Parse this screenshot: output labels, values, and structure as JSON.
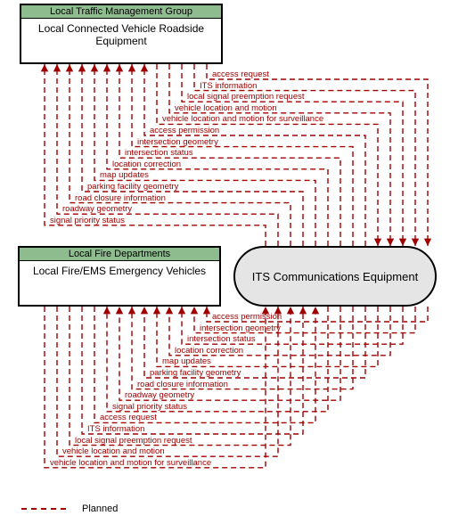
{
  "boxes": {
    "top": {
      "header": "Local Traffic Management Group",
      "body": "Local Connected Vehicle Roadside Equipment"
    },
    "mid": {
      "header": "Local Fire Departments",
      "body": "Local Fire/EMS Emergency Vehicles"
    },
    "oval": "ITS Communications Equipment"
  },
  "flows_top": [
    "access request",
    "ITS information",
    "local signal preemption request",
    "vehicle location and motion",
    "vehicle location and motion for surveillance",
    "access permission",
    "intersection geometry",
    "intersection status",
    "location correction",
    "map updates",
    "parking facility geometry",
    "road closure information",
    "roadway geometry",
    "signal priority status"
  ],
  "flows_bottom": [
    "access permission",
    "intersection geometry",
    "intersection status",
    "location correction",
    "map updates",
    "parking facility geometry",
    "road closure information",
    "roadway geometry",
    "signal priority status",
    "access request",
    "ITS information",
    "local signal preemption request",
    "vehicle location and motion",
    "vehicle location and motion for surveillance"
  ],
  "legend": "Planned",
  "colors": {
    "flow": "#a00000",
    "header_bg": "#8fbc8f",
    "oval_bg": "#e5e5e5"
  },
  "chart_data": {
    "type": "diagram",
    "title": "",
    "nodes": [
      {
        "id": "rse",
        "label": "Local Connected Vehicle Roadside Equipment",
        "group": "Local Traffic Management Group"
      },
      {
        "id": "ems",
        "label": "Local Fire/EMS Emergency Vehicles",
        "group": "Local Fire Departments"
      },
      {
        "id": "its",
        "label": "ITS Communications Equipment",
        "group": ""
      }
    ],
    "edges": [
      {
        "from": "rse",
        "to": "its",
        "label": "access request",
        "style": "planned"
      },
      {
        "from": "rse",
        "to": "its",
        "label": "ITS information",
        "style": "planned"
      },
      {
        "from": "rse",
        "to": "its",
        "label": "local signal preemption request",
        "style": "planned"
      },
      {
        "from": "rse",
        "to": "its",
        "label": "vehicle location and motion",
        "style": "planned"
      },
      {
        "from": "rse",
        "to": "its",
        "label": "vehicle location and motion for surveillance",
        "style": "planned"
      },
      {
        "from": "its",
        "to": "rse",
        "label": "access permission",
        "style": "planned"
      },
      {
        "from": "its",
        "to": "rse",
        "label": "intersection geometry",
        "style": "planned"
      },
      {
        "from": "its",
        "to": "rse",
        "label": "intersection status",
        "style": "planned"
      },
      {
        "from": "its",
        "to": "rse",
        "label": "location correction",
        "style": "planned"
      },
      {
        "from": "its",
        "to": "rse",
        "label": "map updates",
        "style": "planned"
      },
      {
        "from": "its",
        "to": "rse",
        "label": "parking facility geometry",
        "style": "planned"
      },
      {
        "from": "its",
        "to": "rse",
        "label": "road closure information",
        "style": "planned"
      },
      {
        "from": "its",
        "to": "rse",
        "label": "roadway geometry",
        "style": "planned"
      },
      {
        "from": "its",
        "to": "rse",
        "label": "signal priority status",
        "style": "planned"
      },
      {
        "from": "its",
        "to": "ems",
        "label": "access permission",
        "style": "planned"
      },
      {
        "from": "its",
        "to": "ems",
        "label": "intersection geometry",
        "style": "planned"
      },
      {
        "from": "its",
        "to": "ems",
        "label": "intersection status",
        "style": "planned"
      },
      {
        "from": "its",
        "to": "ems",
        "label": "location correction",
        "style": "planned"
      },
      {
        "from": "its",
        "to": "ems",
        "label": "map updates",
        "style": "planned"
      },
      {
        "from": "its",
        "to": "ems",
        "label": "parking facility geometry",
        "style": "planned"
      },
      {
        "from": "its",
        "to": "ems",
        "label": "road closure information",
        "style": "planned"
      },
      {
        "from": "its",
        "to": "ems",
        "label": "roadway geometry",
        "style": "planned"
      },
      {
        "from": "its",
        "to": "ems",
        "label": "signal priority status",
        "style": "planned"
      },
      {
        "from": "ems",
        "to": "its",
        "label": "access request",
        "style": "planned"
      },
      {
        "from": "ems",
        "to": "its",
        "label": "ITS information",
        "style": "planned"
      },
      {
        "from": "ems",
        "to": "its",
        "label": "local signal preemption request",
        "style": "planned"
      },
      {
        "from": "ems",
        "to": "its",
        "label": "vehicle location and motion",
        "style": "planned"
      },
      {
        "from": "ems",
        "to": "its",
        "label": "vehicle location and motion for surveillance",
        "style": "planned"
      }
    ],
    "legend": [
      {
        "style": "dashed",
        "color": "#a00000",
        "label": "Planned"
      }
    ]
  }
}
